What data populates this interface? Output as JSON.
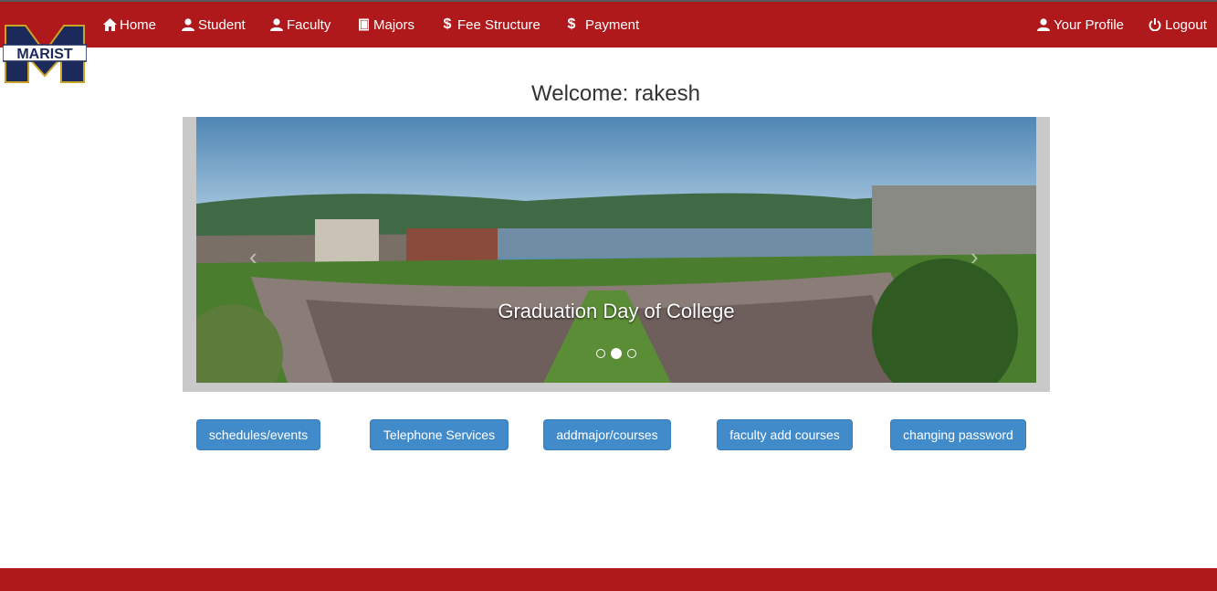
{
  "header": {
    "logo_text": "MARIST",
    "nav_left": [
      {
        "label": "Home",
        "icon": "home-icon"
      },
      {
        "label": "Student",
        "icon": "user-icon"
      },
      {
        "label": "Faculty",
        "icon": "user-icon"
      },
      {
        "label": "Majors",
        "icon": "book-icon"
      },
      {
        "label": "Fee Structure",
        "icon": "dollar-icon"
      },
      {
        "label": "Payment",
        "icon": "dollar-icon"
      }
    ],
    "nav_right": [
      {
        "label": "Your Profile",
        "icon": "user-icon"
      },
      {
        "label": "Logout",
        "icon": "power-icon"
      }
    ]
  },
  "main": {
    "welcome": "Welcome: rakesh",
    "carousel": {
      "caption": "Graduation Day of College",
      "slide_count": 3,
      "active_slide": 2
    },
    "buttons": [
      "schedules/events",
      "Telephone Services",
      "addmajor/courses",
      "faculty add courses",
      "changing password"
    ]
  },
  "colors": {
    "navbar": "#b0191c",
    "button": "#428bca",
    "logo_navy": "#1b2a5a",
    "logo_gold": "#c9a227"
  }
}
